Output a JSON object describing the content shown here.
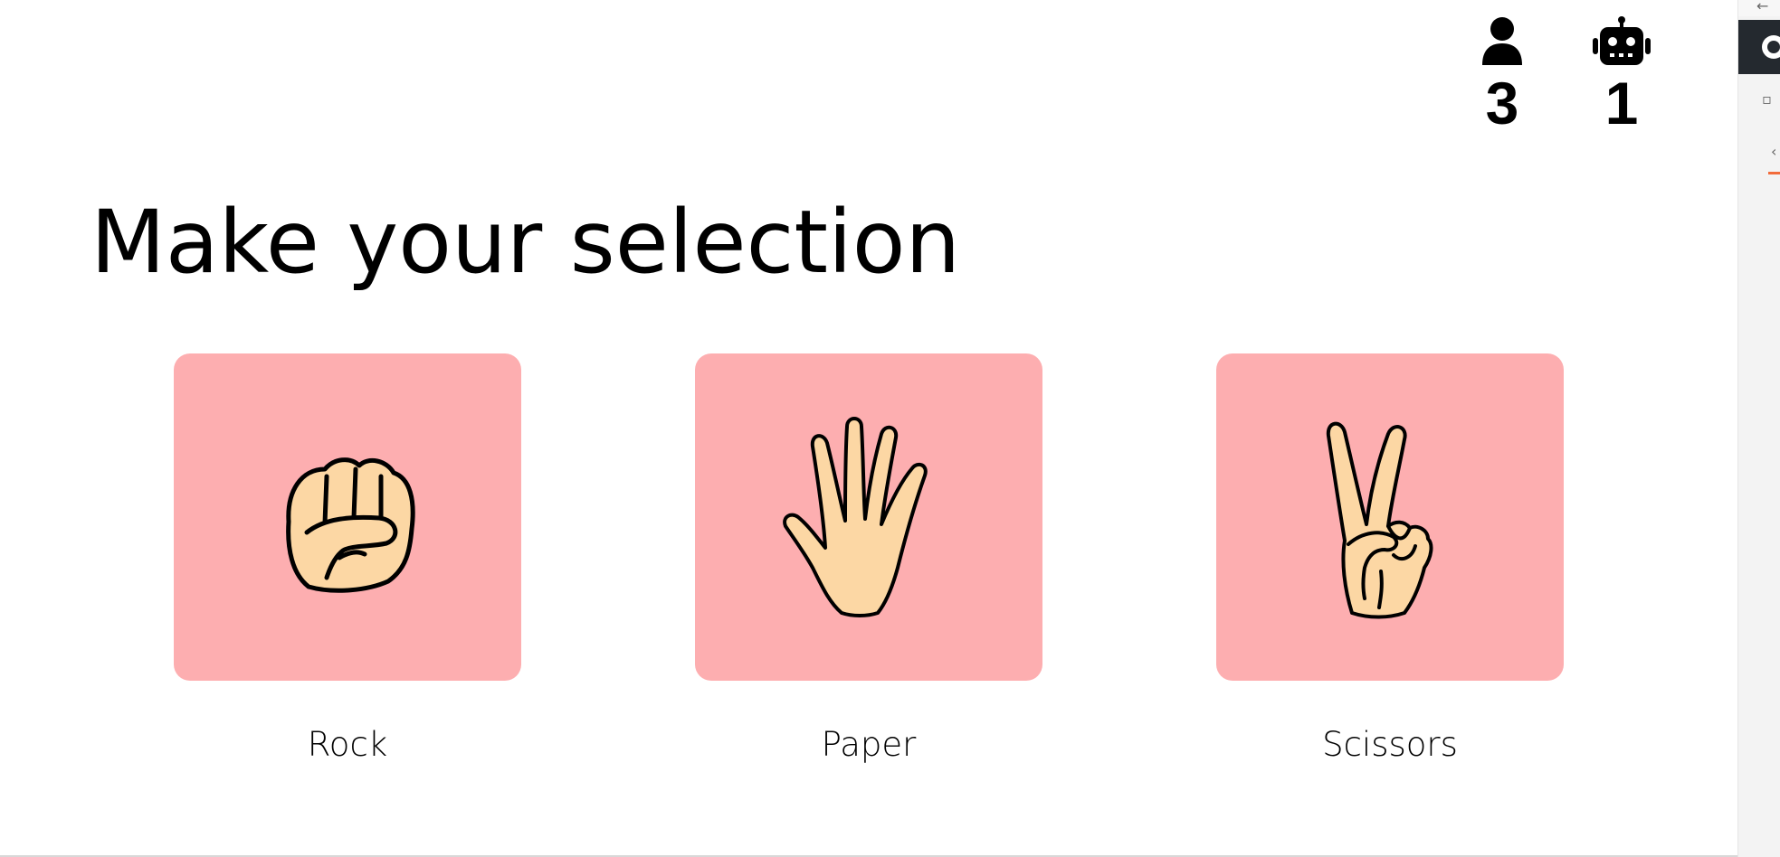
{
  "scoreboard": {
    "player": {
      "icon": "user-icon",
      "score": "3"
    },
    "bot": {
      "icon": "robot-icon",
      "score": "1"
    }
  },
  "title": "Make your selection",
  "choices": [
    {
      "id": "rock",
      "label": "Rock",
      "icon": "fist-hand-icon"
    },
    {
      "id": "paper",
      "label": "Paper",
      "icon": "open-hand-icon"
    },
    {
      "id": "scissors",
      "label": "Scissors",
      "icon": "peace-hand-icon"
    }
  ],
  "colors": {
    "card_background": "#fdaeb0",
    "skin": "#fcd7a4",
    "text": "#000000"
  }
}
